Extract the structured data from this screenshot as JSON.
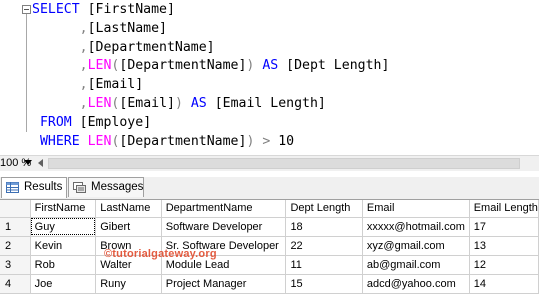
{
  "editor": {
    "lines": [
      {
        "indent": "",
        "parts": [
          {
            "t": "SELECT",
            "c": "kw"
          },
          {
            "t": " ",
            "c": "tx"
          },
          {
            "t": "[FirstName]",
            "c": "tx"
          }
        ]
      },
      {
        "indent": "      ",
        "parts": [
          {
            "t": ",",
            "c": "gr"
          },
          {
            "t": "[LastName]",
            "c": "tx"
          }
        ]
      },
      {
        "indent": "      ",
        "parts": [
          {
            "t": ",",
            "c": "gr"
          },
          {
            "t": "[DepartmentName]",
            "c": "tx"
          }
        ]
      },
      {
        "indent": "      ",
        "parts": [
          {
            "t": ",",
            "c": "gr"
          },
          {
            "t": "LEN",
            "c": "fn"
          },
          {
            "t": "(",
            "c": "gr"
          },
          {
            "t": "[DepartmentName]",
            "c": "tx"
          },
          {
            "t": ")",
            "c": "gr"
          },
          {
            "t": " ",
            "c": "tx"
          },
          {
            "t": "AS",
            "c": "kw"
          },
          {
            "t": " ",
            "c": "tx"
          },
          {
            "t": "[Dept Length]",
            "c": "tx"
          }
        ]
      },
      {
        "indent": "      ",
        "parts": [
          {
            "t": ",",
            "c": "gr"
          },
          {
            "t": "[Email]",
            "c": "tx"
          }
        ]
      },
      {
        "indent": "      ",
        "parts": [
          {
            "t": ",",
            "c": "gr"
          },
          {
            "t": "LEN",
            "c": "fn"
          },
          {
            "t": "(",
            "c": "gr"
          },
          {
            "t": "[Email]",
            "c": "tx"
          },
          {
            "t": ")",
            "c": "gr"
          },
          {
            "t": " ",
            "c": "tx"
          },
          {
            "t": "AS",
            "c": "kw"
          },
          {
            "t": " ",
            "c": "tx"
          },
          {
            "t": "[Email Length]",
            "c": "tx"
          }
        ]
      },
      {
        "indent": " ",
        "parts": [
          {
            "t": "FROM",
            "c": "kw"
          },
          {
            "t": " ",
            "c": "tx"
          },
          {
            "t": "[Employe]",
            "c": "tx"
          }
        ]
      },
      {
        "indent": " ",
        "parts": [
          {
            "t": "WHERE",
            "c": "kw"
          },
          {
            "t": " ",
            "c": "tx"
          },
          {
            "t": "LEN",
            "c": "fn"
          },
          {
            "t": "(",
            "c": "gr"
          },
          {
            "t": "[DepartmentName]",
            "c": "tx"
          },
          {
            "t": ")",
            "c": "gr"
          },
          {
            "t": " ",
            "c": "tx"
          },
          {
            "t": ">",
            "c": "gr"
          },
          {
            "t": " 10",
            "c": "tx"
          }
        ]
      }
    ]
  },
  "zoom": {
    "level": "100 %"
  },
  "tabs": {
    "results_label": "Results",
    "messages_label": "Messages"
  },
  "grid": {
    "columns": [
      "",
      "FirstName",
      "LastName",
      "DepartmentName",
      "Dept Length",
      "Email",
      "Email Length"
    ],
    "rows": [
      [
        "1",
        "Guy",
        "Gibert",
        "Software Developer",
        "18",
        "xxxxx@hotmail.com",
        "17"
      ],
      [
        "2",
        "Kevin",
        "Brown",
        "Sr. Software Developer",
        "22",
        "xyz@gmail.com",
        "13"
      ],
      [
        "3",
        "Rob",
        "Walter",
        "Module Lead",
        "11",
        "ab@gmail.com",
        "12"
      ],
      [
        "4",
        "Joe",
        "Runy",
        "Project Manager",
        "15",
        "adcd@yahoo.com",
        "14"
      ]
    ]
  },
  "watermark": "©tutorialgateway.org",
  "colors": {
    "keyword": "#0000ff",
    "function": "#ff00ff",
    "operator": "#808080",
    "identifier": "#000000"
  }
}
